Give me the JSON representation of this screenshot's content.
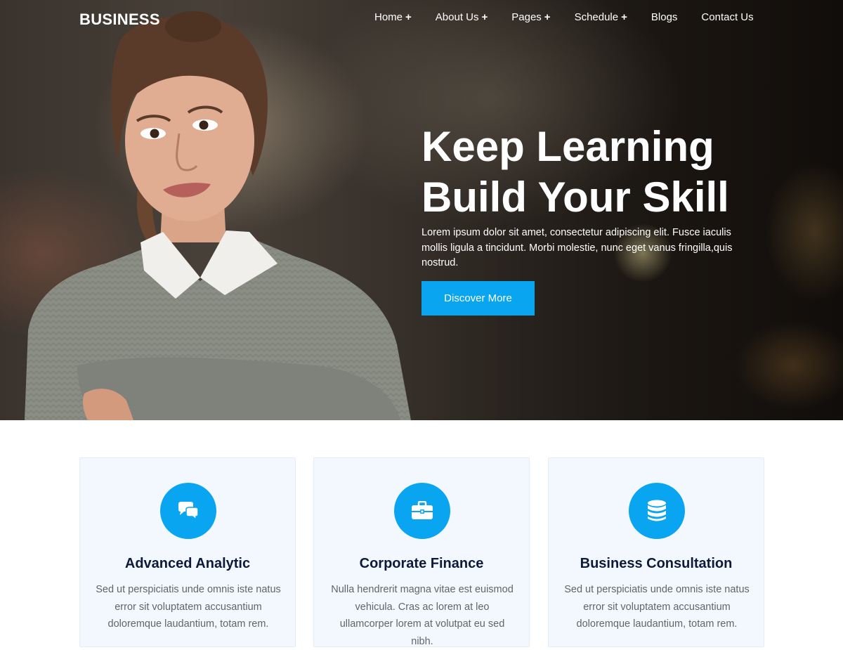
{
  "header": {
    "logo": "BUSINESS",
    "nav": [
      {
        "label": "Home",
        "has_submenu": true
      },
      {
        "label": "About Us",
        "has_submenu": true
      },
      {
        "label": "Pages",
        "has_submenu": true
      },
      {
        "label": "Schedule",
        "has_submenu": true
      },
      {
        "label": "Blogs",
        "has_submenu": false
      },
      {
        "label": "Contact Us",
        "has_submenu": false
      }
    ],
    "submenu_indicator": "+"
  },
  "hero": {
    "title_line1": "Keep Learning",
    "title_line2": "Build Your Skill",
    "text": "Lorem ipsum dolor sit amet, consectetur adipiscing elit. Fusce iaculis mollis ligula a tincidunt. Morbi molestie, nunc eget vanus fringilla,quis nostrud.",
    "button_label": "Discover More"
  },
  "services": [
    {
      "icon": "comments-icon",
      "title": "Advanced Analytic",
      "text": "Sed ut perspiciatis unde omnis iste natus error sit voluptatem accusantium doloremque laudantium, totam rem."
    },
    {
      "icon": "briefcase-icon",
      "title": "Corporate Finance",
      "text": "Nulla hendrerit magna vitae est euismod vehicula. Cras ac lorem at leo ullamcorper lorem at volutpat eu sed nibh."
    },
    {
      "icon": "database-icon",
      "title": "Business Consultation",
      "text": "Sed ut perspiciatis unde omnis iste natus error sit voluptatem accusantium doloremque laudantium, totam rem."
    }
  ],
  "colors": {
    "accent": "#0aa5f1",
    "card_background": "#f3f8fe",
    "card_title": "#0e1a3c",
    "body_text": "#5f6570"
  }
}
